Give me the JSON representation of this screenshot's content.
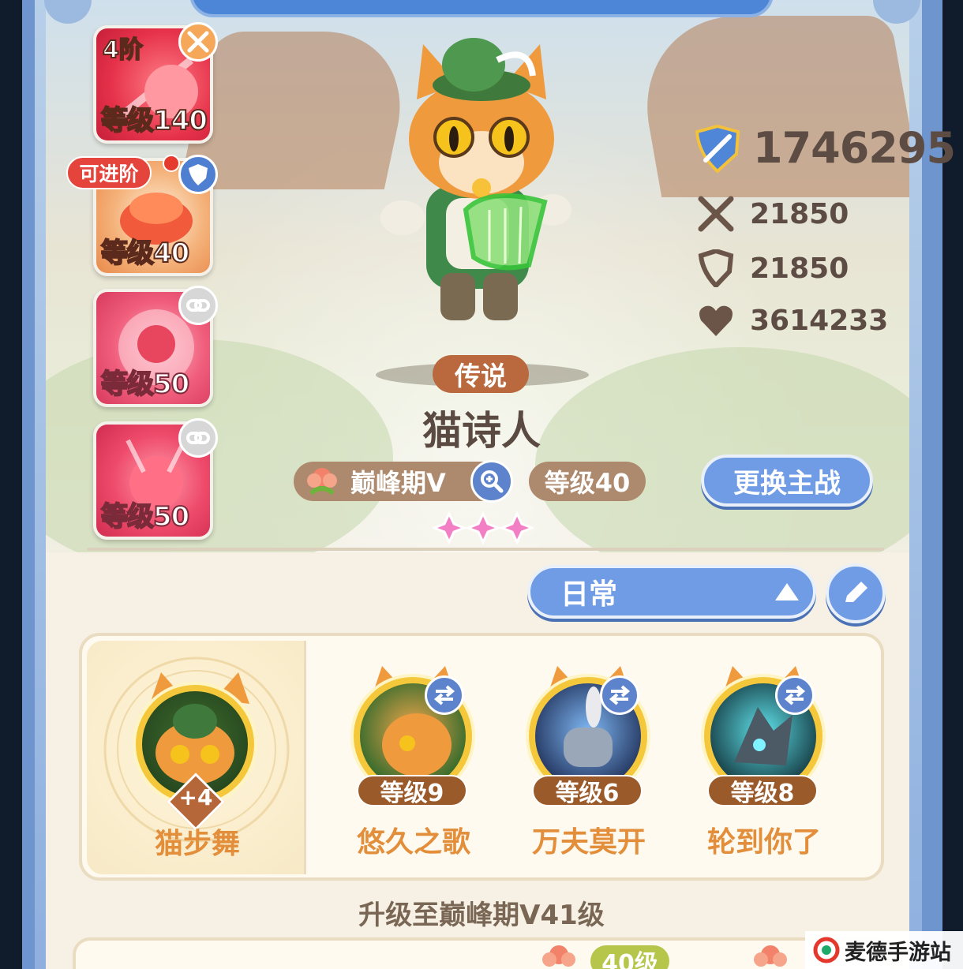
{
  "left_cards": [
    {
      "tier": "4阶",
      "level": "等级140",
      "badge": "crossed-swords-icon"
    },
    {
      "tag": "可进阶",
      "level": "等级40",
      "badge": "shield-icon"
    },
    {
      "level": "等级50",
      "badge": "link-icon"
    },
    {
      "level": "等级50",
      "badge": "link-icon"
    }
  ],
  "hero": {
    "rarity": "传说",
    "name": "猫诗人",
    "stage": "巅峰期V",
    "level": "等级40",
    "stars": 3
  },
  "switch_button": "更换主战",
  "stats": {
    "power": "1746295",
    "attack": "21850",
    "defense": "21850",
    "hp": "3614233"
  },
  "mode": {
    "label": "日常"
  },
  "skills": {
    "main": {
      "name": "猫步舞",
      "bonus": "+4"
    },
    "list": [
      {
        "name": "悠久之歌",
        "level": "等级9"
      },
      {
        "name": "万夫莫开",
        "level": "等级6"
      },
      {
        "name": "轮到你了",
        "level": "等级8"
      }
    ]
  },
  "upgrade_text": "升级至巅峰期V41级",
  "bottom_tag": "40级",
  "watermark": "麦德手游站",
  "colors": {
    "accent_blue": "#6f9ce4",
    "rarity_brown": "#b9693d",
    "skill_orange": "#e28e3a"
  }
}
